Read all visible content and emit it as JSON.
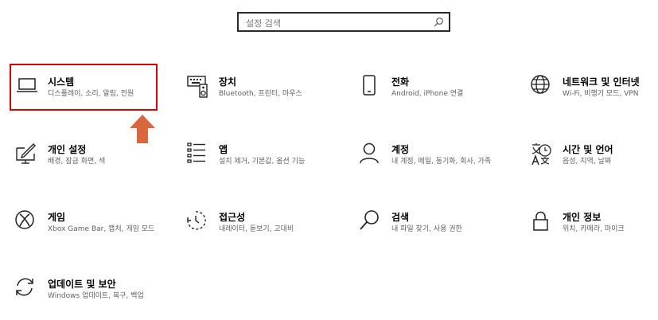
{
  "search": {
    "placeholder": "설정 검색"
  },
  "tiles": [
    {
      "title": "시스템",
      "desc": "디스플레이, 소리, 알림, 전원",
      "icon": "laptop-icon"
    },
    {
      "title": "장치",
      "desc": "Bluetooth, 프린터, 마우스",
      "icon": "keyboard-speaker-icon"
    },
    {
      "title": "전화",
      "desc": "Android, iPhone 연결",
      "icon": "phone-icon"
    },
    {
      "title": "네트워크 및 인터넷",
      "desc": "Wi-Fi, 비행기 모드, VPN",
      "icon": "globe-icon"
    },
    {
      "title": "개인 설정",
      "desc": "배경, 잠금 화면, 색",
      "icon": "paint-icon"
    },
    {
      "title": "앱",
      "desc": "설치 제거, 기본값, 옵션 기능",
      "icon": "apps-list-icon"
    },
    {
      "title": "계정",
      "desc": "내 계정, 메일, 동기화, 회사, 가족",
      "icon": "person-icon"
    },
    {
      "title": "시간 및 언어",
      "desc": "음성, 지역, 날짜",
      "icon": "time-language-icon"
    },
    {
      "title": "게임",
      "desc": "Xbox Game Bar, 캡처, 게임 모드",
      "icon": "xbox-icon"
    },
    {
      "title": "접근성",
      "desc": "내레이터, 돋보기, 고대비",
      "icon": "accessibility-timer-icon"
    },
    {
      "title": "검색",
      "desc": "내 파일 찾기, 사용 권한",
      "icon": "search-magnifier-icon"
    },
    {
      "title": "개인 정보",
      "desc": "위치, 카메라, 마이크",
      "icon": "lock-icon"
    },
    {
      "title": "업데이트 및 보안",
      "desc": "Windows 업데이트, 복구, 백업",
      "icon": "update-sync-icon"
    }
  ],
  "colors": {
    "highlight": "#e00000",
    "arrow": "#d9663c"
  }
}
